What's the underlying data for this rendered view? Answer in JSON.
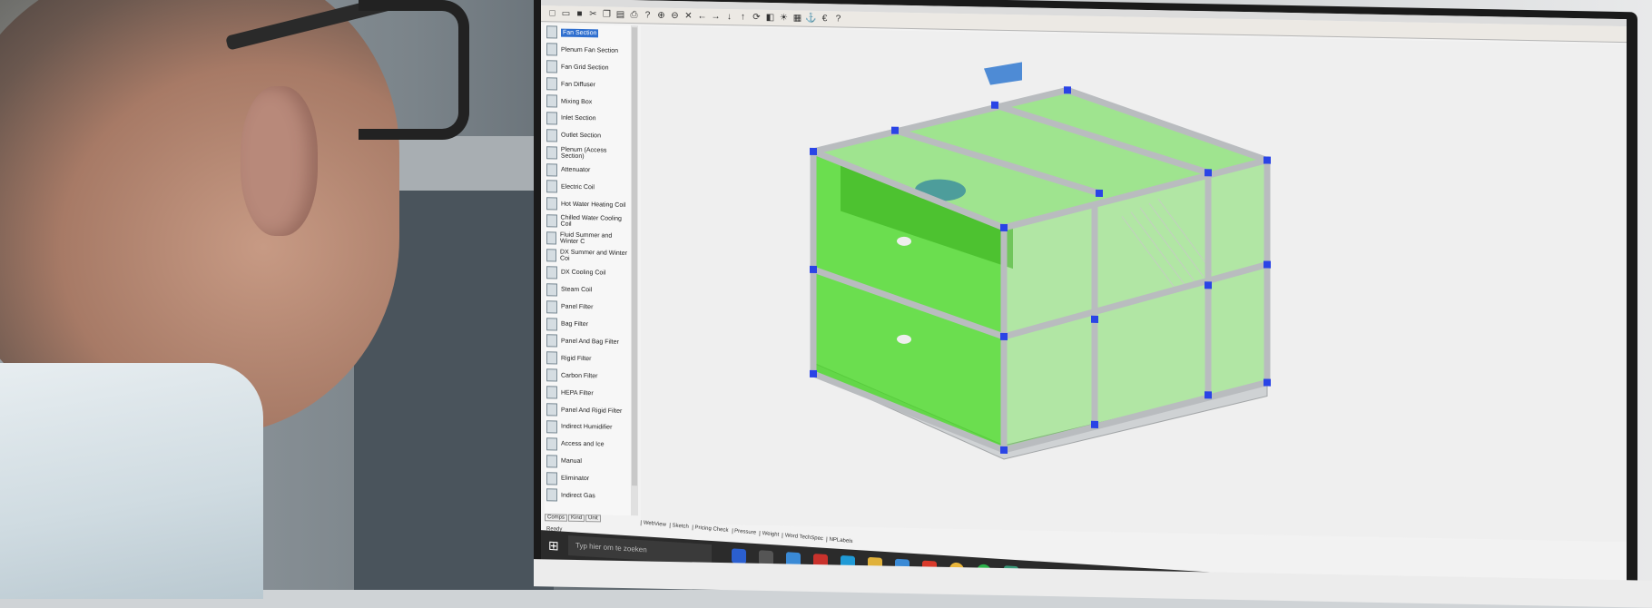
{
  "toolbar": {
    "icons": [
      "new",
      "open",
      "save",
      "cut",
      "copy",
      "paste",
      "print",
      "help",
      "zoom-in",
      "zoom-out",
      "close",
      "arrow-left",
      "arrow-right",
      "arrow-down",
      "arrow-up",
      "rotate",
      "view",
      "light",
      "grid",
      "anchor",
      "euro",
      "question"
    ]
  },
  "sidebar": {
    "items": [
      {
        "label": "Fan Section",
        "active": true
      },
      {
        "label": "Plenum Fan Section"
      },
      {
        "label": "Fan Grid Section"
      },
      {
        "label": "Fan Diffuser"
      },
      {
        "label": "Mixing Box"
      },
      {
        "label": "Inlet Section"
      },
      {
        "label": "Outlet Section"
      },
      {
        "label": "Plenum (Access Section)"
      },
      {
        "label": "Attenuator"
      },
      {
        "label": "Electric Coil"
      },
      {
        "label": "Hot Water Heating Coil"
      },
      {
        "label": "Chilled Water Cooling Coil"
      },
      {
        "label": "Fluid Summer and Winter C"
      },
      {
        "label": "DX Summer and Winter Coi"
      },
      {
        "label": "DX Cooling Coil"
      },
      {
        "label": "Steam Coil"
      },
      {
        "label": "Panel Filter"
      },
      {
        "label": "Bag Filter"
      },
      {
        "label": "Panel And Bag Filter"
      },
      {
        "label": "Rigid Filter"
      },
      {
        "label": "Carbon Filter"
      },
      {
        "label": "HEPA Filter"
      },
      {
        "label": "Panel And Rigid Filter"
      },
      {
        "label": "Indirect Humidifier"
      },
      {
        "label": "Access and Ice"
      },
      {
        "label": "Manual"
      },
      {
        "label": "Eliminator"
      },
      {
        "label": "Indirect Gas"
      }
    ],
    "tabs": [
      "Comps",
      "Kind",
      "Unit"
    ],
    "status": "Ready"
  },
  "canvas": {
    "tabs": [
      "WebView",
      "Sketch",
      "Pricing Check",
      "Pressure",
      "Weight",
      "Word TechSpec",
      "NPLabels"
    ]
  },
  "taskbar": {
    "search_placeholder": "Typ hier om te zoeken"
  },
  "colors": {
    "unit_green": "#3fd81a",
    "frame_gray": "#b9bcbf",
    "corner_blue": "#2a44e6"
  }
}
